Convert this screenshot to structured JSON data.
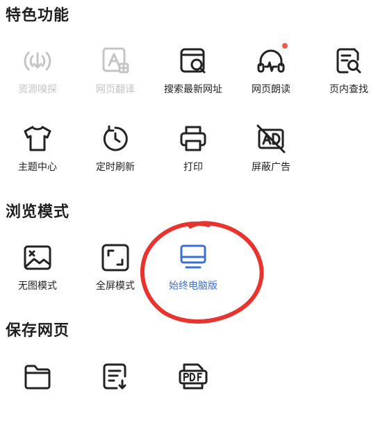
{
  "sections": {
    "features": {
      "title": "特色功能",
      "items": [
        {
          "label": "资源嗅探",
          "icon": "sniff-icon",
          "state": "disabled"
        },
        {
          "label": "网页翻译",
          "icon": "translate-icon",
          "state": "disabled"
        },
        {
          "label": "搜索最新网址",
          "icon": "web-search-icon",
          "state": "normal"
        },
        {
          "label": "网页朗读",
          "icon": "headphones-icon",
          "state": "normal",
          "badge": true
        },
        {
          "label": "页内查找",
          "icon": "find-in-page-icon",
          "state": "normal"
        },
        {
          "label": "主题中心",
          "icon": "tshirt-icon",
          "state": "normal"
        },
        {
          "label": "定时刷新",
          "icon": "timer-refresh-icon",
          "state": "normal"
        },
        {
          "label": "打印",
          "icon": "printer-icon",
          "state": "normal"
        },
        {
          "label": "屏蔽广告",
          "icon": "ad-block-icon",
          "state": "normal"
        }
      ]
    },
    "browse_mode": {
      "title": "浏览模式",
      "items": [
        {
          "label": "无图模式",
          "icon": "no-image-icon",
          "state": "normal"
        },
        {
          "label": "全屏模式",
          "icon": "fullscreen-icon",
          "state": "normal"
        },
        {
          "label": "始终电脑版",
          "icon": "desktop-icon",
          "state": "active"
        }
      ]
    },
    "save_page": {
      "title": "保存网页",
      "items": [
        {
          "icon": "folder-icon"
        },
        {
          "icon": "save-text-icon"
        },
        {
          "icon": "pdf-icon"
        }
      ]
    }
  },
  "colors": {
    "text": "#222222",
    "disabled": "#c4c4c4",
    "active": "#3b6fd6",
    "badge": "#f05a4a",
    "annotation": "#e8332e"
  }
}
